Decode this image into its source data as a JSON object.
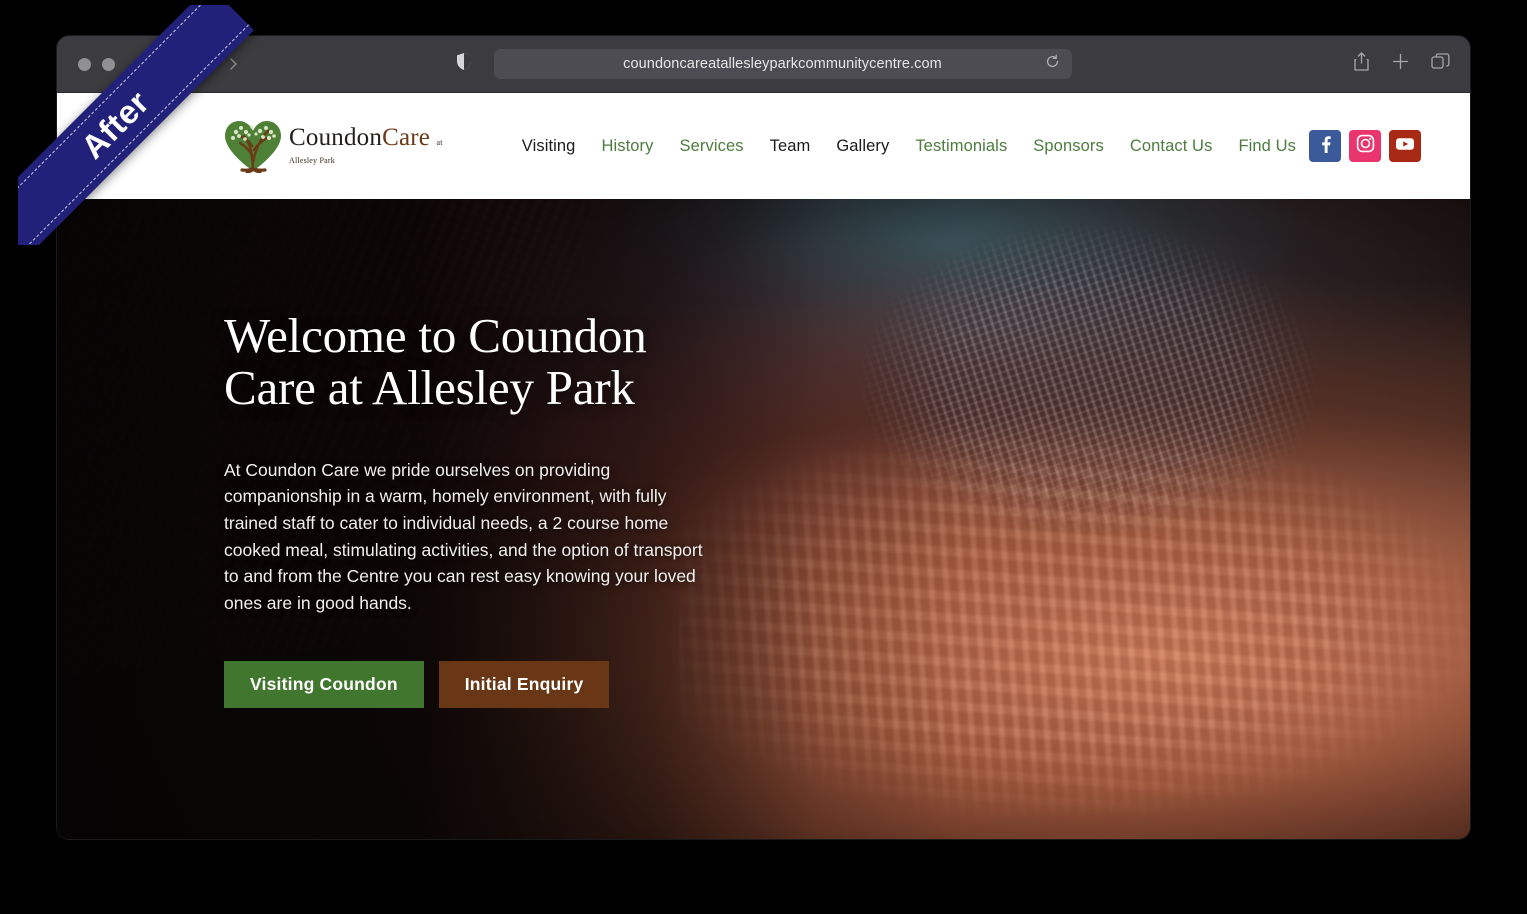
{
  "ribbon": {
    "label": "After"
  },
  "browser": {
    "traffic_lights": [
      "close",
      "minimize",
      "zoom"
    ],
    "back_icon": "chevron-left-icon",
    "forward_icon": "chevron-right-icon",
    "privacy_icon": "shield-icon",
    "url": "coundoncareatallesleyparkcommunitycentre.com",
    "reload_icon": "reload-icon",
    "share_icon": "share-icon",
    "newtab_icon": "plus-icon",
    "tabs_icon": "tab-overview-icon"
  },
  "site": {
    "logo": {
      "mark": "green-heart-tree-icon",
      "name_first": "Coundon",
      "name_second": "Care",
      "subtitle": "at Allesley Park"
    },
    "nav": [
      {
        "label": "Visiting",
        "color": "dark"
      },
      {
        "label": "History",
        "color": "green"
      },
      {
        "label": "Services",
        "color": "green"
      },
      {
        "label": "Team",
        "color": "dark"
      },
      {
        "label": "Gallery",
        "color": "dark"
      },
      {
        "label": "Testimonials",
        "color": "green"
      },
      {
        "label": "Sponsors",
        "color": "green"
      },
      {
        "label": "Contact Us",
        "color": "green"
      },
      {
        "label": "Find Us",
        "color": "green"
      }
    ],
    "socials": [
      {
        "name": "facebook",
        "icon": "facebook-icon",
        "color": "#3b5a9a"
      },
      {
        "name": "instagram",
        "icon": "instagram-icon",
        "color": "#e8356d"
      },
      {
        "name": "youtube",
        "icon": "youtube-icon",
        "color": "#a92a14"
      }
    ]
  },
  "hero": {
    "title_line1": "Welcome to Coundon",
    "title_line2": "Care at Allesley Park",
    "body": "At Coundon Care we pride ourselves on providing companionship in a warm, homely environment, with fully trained staff to cater to individual needs, a 2 course home cooked meal, stimulating activities, and the option of transport to and from the Centre you can rest easy knowing your loved ones are in good hands.",
    "primary_button": "Visiting Coundon",
    "secondary_button": "Initial Enquiry",
    "image_alt": "elderly-hands-clasped-photo"
  },
  "colors": {
    "brand_green": "#4c7c3e",
    "brand_brown": "#6d3a18",
    "button_green": "#41762f",
    "button_brown": "#693716",
    "ribbon_navy": "#21217a"
  }
}
